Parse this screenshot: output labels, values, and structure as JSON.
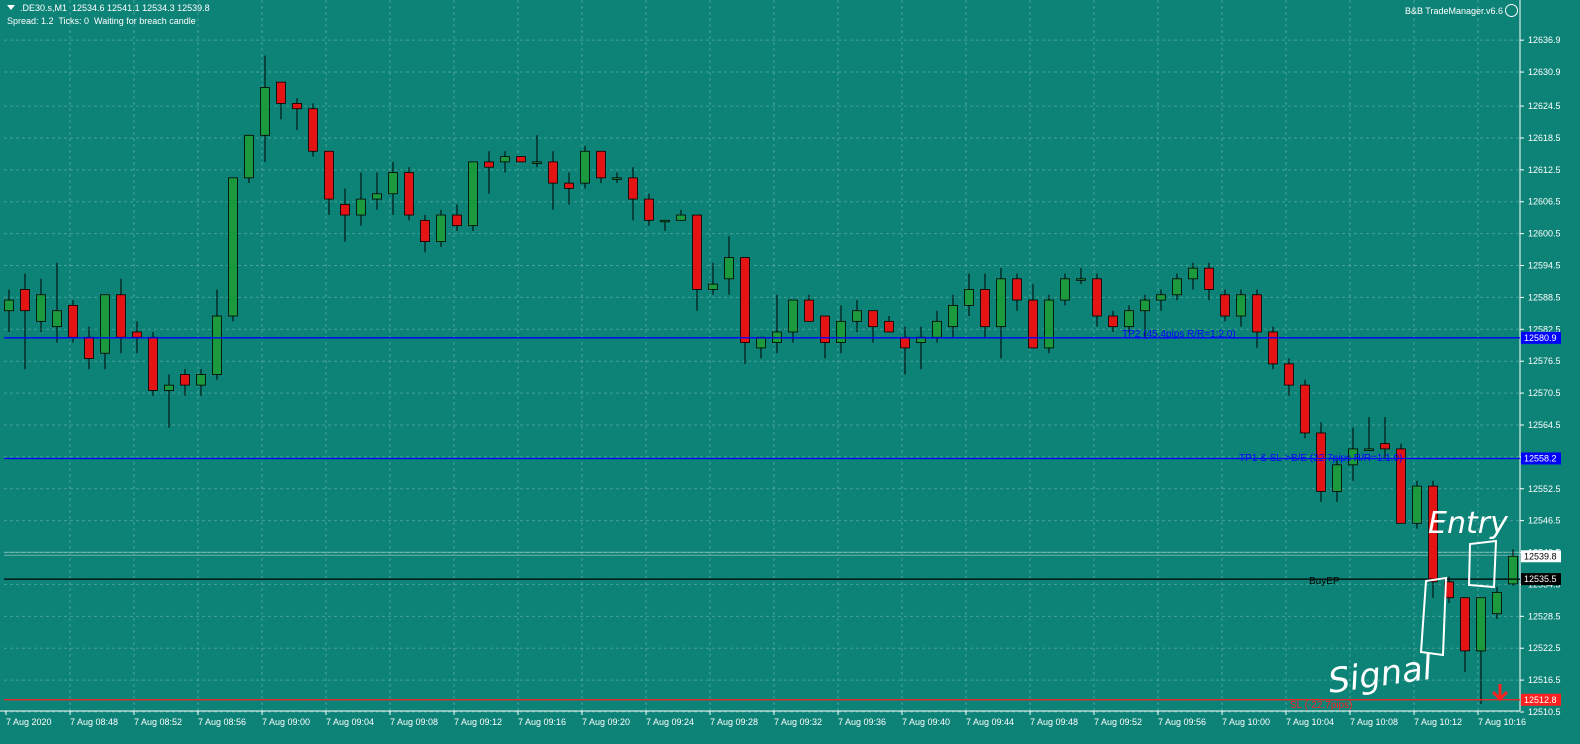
{
  "header": {
    "symbol_line": ".DE30.s,M1  12534.6 12541.1 12534.3 12539.8",
    "status_line": "Spread: 1.2  Ticks: 0  Waiting for breach candle",
    "indicator": "B&B TradeManager.v6.6"
  },
  "colors": {
    "background": "#0d8377",
    "grid": "#76b8b0",
    "bull": "#1a9a3c",
    "bear": "#e31414",
    "tp_line": "#0000ff",
    "entry_line": "#000000",
    "sl_line": "#ff2020",
    "annotation": "#ffffff"
  },
  "price_axis": {
    "min": 12510.5,
    "max": 12639.0,
    "ticks": [
      "12636.9",
      "12630.9",
      "12624.5",
      "12618.5",
      "12612.5",
      "12606.5",
      "12600.5",
      "12594.5",
      "12588.5",
      "12582.5",
      "12576.5",
      "12570.5",
      "12564.5",
      "12558.5",
      "12552.5",
      "12546.5",
      "12540.5",
      "12534.5",
      "12528.5",
      "12522.5",
      "12516.5",
      "12510.5"
    ]
  },
  "time_axis": {
    "labels": [
      "7 Aug 2020",
      "7 Aug 08:48",
      "7 Aug 08:52",
      "7 Aug 08:56",
      "7 Aug 09:00",
      "7 Aug 09:04",
      "7 Aug 09:08",
      "7 Aug 09:12",
      "7 Aug 09:16",
      "7 Aug 09:20",
      "7 Aug 09:24",
      "7 Aug 09:28",
      "7 Aug 09:32",
      "7 Aug 09:36",
      "7 Aug 09:40",
      "7 Aug 09:44",
      "7 Aug 09:48",
      "7 Aug 09:52",
      "7 Aug 09:56",
      "7 Aug 10:00",
      "7 Aug 10:04",
      "7 Aug 10:08",
      "7 Aug 10:12",
      "7 Aug 10:16"
    ]
  },
  "levels": [
    {
      "name": "tp2",
      "price": 12580.9,
      "label": "TP2 (45.4pips R/R=1:2.0)",
      "tag": "12580.9",
      "color": "#0000ff"
    },
    {
      "name": "tp1",
      "price": 12558.2,
      "label": "TP1 & SL->B/E (22.7pips R/R=1:1.0)",
      "tag": "12558.2",
      "color": "#0000ff"
    },
    {
      "name": "entry",
      "price": 12535.5,
      "label": "BuyEP",
      "tag": "12535.5",
      "color": "#000000"
    },
    {
      "name": "sl",
      "price": 12512.8,
      "label": "SL (-22.7pips)",
      "tag": "12512.8",
      "color": "#ff2020"
    }
  ],
  "current_price": "12539.8",
  "annotations": {
    "entry": "Entry",
    "signal": "Signal"
  },
  "chart_data": {
    "type": "candlestick",
    "series": [
      {
        "o": 12586,
        "h": 12590,
        "l": 12582,
        "c": 12588
      },
      {
        "o": 12590,
        "h": 12593,
        "l": 12575,
        "c": 12586
      },
      {
        "o": 12584,
        "h": 12592,
        "l": 12582,
        "c": 12589
      },
      {
        "o": 12583,
        "h": 12595,
        "l": 12580,
        "c": 12586
      },
      {
        "o": 12587,
        "h": 12588,
        "l": 12580,
        "c": 12581
      },
      {
        "o": 12581,
        "h": 12583,
        "l": 12575,
        "c": 12577
      },
      {
        "o": 12578,
        "h": 12582,
        "l": 12575,
        "c": 12589
      },
      {
        "o": 12589,
        "h": 12592,
        "l": 12578,
        "c": 12581
      },
      {
        "o": 12582,
        "h": 12584,
        "l": 12578,
        "c": 12581
      },
      {
        "o": 12581,
        "h": 12582,
        "l": 12570,
        "c": 12571
      },
      {
        "o": 12571,
        "h": 12574,
        "l": 12564,
        "c": 12572
      },
      {
        "o": 12574,
        "h": 12575,
        "l": 12570,
        "c": 12572
      },
      {
        "o": 12572,
        "h": 12575,
        "l": 12570,
        "c": 12574
      },
      {
        "o": 12574,
        "h": 12590,
        "l": 12573,
        "c": 12585
      },
      {
        "o": 12585,
        "h": 12611,
        "l": 12584,
        "c": 12611
      },
      {
        "o": 12611,
        "h": 12619,
        "l": 12610,
        "c": 12619
      },
      {
        "o": 12619,
        "h": 12634,
        "l": 12614,
        "c": 12628
      },
      {
        "o": 12629,
        "h": 12629,
        "l": 12622,
        "c": 12625
      },
      {
        "o": 12625,
        "h": 12626,
        "l": 12620,
        "c": 12624
      },
      {
        "o": 12624,
        "h": 12625,
        "l": 12615,
        "c": 12616
      },
      {
        "o": 12616,
        "h": 12616,
        "l": 12604,
        "c": 12607
      },
      {
        "o": 12606,
        "h": 12609,
        "l": 12599,
        "c": 12604
      },
      {
        "o": 12604,
        "h": 12612,
        "l": 12602,
        "c": 12607
      },
      {
        "o": 12607,
        "h": 12612,
        "l": 12605,
        "c": 12608
      },
      {
        "o": 12608,
        "h": 12614,
        "l": 12604,
        "c": 12612
      },
      {
        "o": 12612,
        "h": 12613,
        "l": 12603,
        "c": 12604
      },
      {
        "o": 12603,
        "h": 12604,
        "l": 12597,
        "c": 12599
      },
      {
        "o": 12599,
        "h": 12605,
        "l": 12598,
        "c": 12604
      },
      {
        "o": 12604,
        "h": 12606,
        "l": 12601,
        "c": 12602
      },
      {
        "o": 12602,
        "h": 12614,
        "l": 12601,
        "c": 12614
      },
      {
        "o": 12614,
        "h": 12616,
        "l": 12608,
        "c": 12613
      },
      {
        "o": 12614,
        "h": 12616,
        "l": 12612,
        "c": 12615
      },
      {
        "o": 12615,
        "h": 12615,
        "l": 12614,
        "c": 12614
      },
      {
        "o": 12614,
        "h": 12619,
        "l": 12613,
        "c": 12614
      },
      {
        "o": 12614,
        "h": 12616,
        "l": 12605,
        "c": 12610
      },
      {
        "o": 12610,
        "h": 12612,
        "l": 12606,
        "c": 12609
      },
      {
        "o": 12610,
        "h": 12617,
        "l": 12609,
        "c": 12616
      },
      {
        "o": 12616,
        "h": 12616,
        "l": 12610,
        "c": 12611
      },
      {
        "o": 12611,
        "h": 12612,
        "l": 12610,
        "c": 12611
      },
      {
        "o": 12611,
        "h": 12613,
        "l": 12603,
        "c": 12607
      },
      {
        "o": 12607,
        "h": 12608,
        "l": 12602,
        "c": 12603
      },
      {
        "o": 12603,
        "h": 12603,
        "l": 12601,
        "c": 12603
      },
      {
        "o": 12603,
        "h": 12605,
        "l": 12603,
        "c": 12604
      },
      {
        "o": 12604,
        "h": 12604,
        "l": 12586,
        "c": 12590
      },
      {
        "o": 12590,
        "h": 12595,
        "l": 12589,
        "c": 12591
      },
      {
        "o": 12592,
        "h": 12600,
        "l": 12589,
        "c": 12596
      },
      {
        "o": 12596,
        "h": 12596,
        "l": 12576,
        "c": 12580
      },
      {
        "o": 12579,
        "h": 12581,
        "l": 12577,
        "c": 12581
      },
      {
        "o": 12580,
        "h": 12589,
        "l": 12578,
        "c": 12582
      },
      {
        "o": 12582,
        "h": 12588,
        "l": 12580,
        "c": 12588
      },
      {
        "o": 12588,
        "h": 12589,
        "l": 12584,
        "c": 12584
      },
      {
        "o": 12585,
        "h": 12585,
        "l": 12577,
        "c": 12580
      },
      {
        "o": 12580,
        "h": 12587,
        "l": 12578,
        "c": 12584
      },
      {
        "o": 12584,
        "h": 12588,
        "l": 12582,
        "c": 12586
      },
      {
        "o": 12586,
        "h": 12586,
        "l": 12580,
        "c": 12583
      },
      {
        "o": 12584,
        "h": 12585,
        "l": 12582,
        "c": 12582
      },
      {
        "o": 12581,
        "h": 12583,
        "l": 12574,
        "c": 12579
      },
      {
        "o": 12580,
        "h": 12583,
        "l": 12575,
        "c": 12581
      },
      {
        "o": 12581,
        "h": 12586,
        "l": 12580,
        "c": 12584
      },
      {
        "o": 12583,
        "h": 12589,
        "l": 12581,
        "c": 12587
      },
      {
        "o": 12587,
        "h": 12593,
        "l": 12585,
        "c": 12590
      },
      {
        "o": 12590,
        "h": 12593,
        "l": 12581,
        "c": 12583
      },
      {
        "o": 12583,
        "h": 12594,
        "l": 12577,
        "c": 12592
      },
      {
        "o": 12592,
        "h": 12593,
        "l": 12586,
        "c": 12588
      },
      {
        "o": 12588,
        "h": 12591,
        "l": 12579,
        "c": 12579
      },
      {
        "o": 12579,
        "h": 12589,
        "l": 12578,
        "c": 12588
      },
      {
        "o": 12588,
        "h": 12593,
        "l": 12587,
        "c": 12592
      },
      {
        "o": 12592,
        "h": 12594,
        "l": 12591,
        "c": 12592
      },
      {
        "o": 12592,
        "h": 12593,
        "l": 12583,
        "c": 12585
      },
      {
        "o": 12585,
        "h": 12586,
        "l": 12582,
        "c": 12583
      },
      {
        "o": 12583,
        "h": 12587,
        "l": 12582,
        "c": 12586
      },
      {
        "o": 12586,
        "h": 12589,
        "l": 12581,
        "c": 12588
      },
      {
        "o": 12588,
        "h": 12590,
        "l": 12586,
        "c": 12589
      },
      {
        "o": 12589,
        "h": 12593,
        "l": 12588,
        "c": 12592
      },
      {
        "o": 12592,
        "h": 12595,
        "l": 12590,
        "c": 12594
      },
      {
        "o": 12594,
        "h": 12595,
        "l": 12588,
        "c": 12590
      },
      {
        "o": 12589,
        "h": 12590,
        "l": 12584,
        "c": 12585
      },
      {
        "o": 12585,
        "h": 12590,
        "l": 12583,
        "c": 12589
      },
      {
        "o": 12589,
        "h": 12590,
        "l": 12579,
        "c": 12582
      },
      {
        "o": 12582,
        "h": 12583,
        "l": 12575,
        "c": 12576
      },
      {
        "o": 12576,
        "h": 12577,
        "l": 12570,
        "c": 12572
      },
      {
        "o": 12572,
        "h": 12573,
        "l": 12562,
        "c": 12563
      },
      {
        "o": 12563,
        "h": 12565,
        "l": 12550,
        "c": 12552
      },
      {
        "o": 12552,
        "h": 12558,
        "l": 12550,
        "c": 12557
      },
      {
        "o": 12557,
        "h": 12564,
        "l": 12554,
        "c": 12560
      },
      {
        "o": 12560,
        "h": 12566,
        "l": 12560,
        "c": 12560
      },
      {
        "o": 12561,
        "h": 12566,
        "l": 12558,
        "c": 12560
      },
      {
        "o": 12560,
        "h": 12561,
        "l": 12546,
        "c": 12546
      },
      {
        "o": 12546,
        "h": 12554,
        "l": 12545,
        "c": 12553
      },
      {
        "o": 12553,
        "h": 12554,
        "l": 12532,
        "c": 12535
      },
      {
        "o": 12535,
        "h": 12536,
        "l": 12531,
        "c": 12532
      },
      {
        "o": 12532,
        "h": 12532,
        "l": 12518,
        "c": 12522
      },
      {
        "o": 12522,
        "h": 12532,
        "l": 12512,
        "c": 12532
      },
      {
        "o": 12529,
        "h": 12534,
        "l": 12528,
        "c": 12533
      },
      {
        "o": 12534.6,
        "h": 12541.1,
        "l": 12534.3,
        "c": 12539.8
      }
    ]
  }
}
